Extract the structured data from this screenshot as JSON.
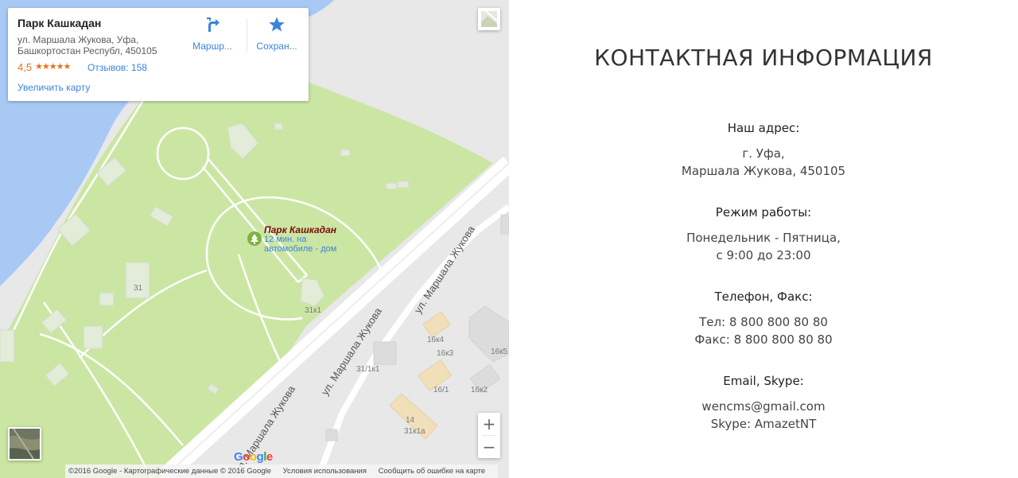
{
  "map": {
    "place": {
      "name": "Парк Кашкадан",
      "address_line1": "ул. Маршала Жукова, Уфа,",
      "address_line2": "Башкортостан Республ, 450105",
      "rating": "4,5",
      "stars": "★★★★★",
      "reviews": "Отзывов: 158",
      "enlarge": "Увеличить карту",
      "route_label": "Маршр...",
      "save_label": "Сохран..."
    },
    "poi": {
      "name": "Парк Кашкадан",
      "route_line1": "12 мин. на",
      "route_line2": "автомобиле - дом"
    },
    "streets": [
      "ул. Маршала Жукова",
      "ул. Маршала Жукова",
      "ул. Маршала Жукова"
    ],
    "building_labels": [
      "31",
      "31к1",
      "16к4",
      "16к3",
      "16к5",
      "31/1к1",
      "16/1",
      "16к2",
      "14",
      "31к1а"
    ],
    "logo": "Google",
    "attribution": {
      "copyright": "©2016 Google - Картографические данные © 2016 Google",
      "terms": "Условия использования",
      "report": "Сообщить об ошибке на карте"
    },
    "zoom_in": "+",
    "zoom_out": "−",
    "colors": {
      "water": "#a9c9f5",
      "park": "#cbe6a3",
      "land": "#e8e8e8",
      "road": "#ffffff",
      "rating": "#e7711b",
      "link": "#3a84df"
    }
  },
  "contact": {
    "title": "КОНТАКТНАЯ ИНФОРМАЦИЯ",
    "address_label": "Наш адрес:",
    "address_line1": "г. Уфа,",
    "address_line2": "Маршала Жукова, 450105",
    "hours_label": "Режим работы:",
    "hours_line1": "Понедельник - Пятница,",
    "hours_line2": "с 9:00 до 23:00",
    "phone_label": "Телефон, Факс:",
    "phone_line": "Тел: 8 800 800 80 80",
    "fax_line": "Факс: 8 800 800 80 80",
    "email_label": "Email, Skype:",
    "email_line": "wencms@gmail.com",
    "skype_line": "Skype: AmazetNT"
  }
}
